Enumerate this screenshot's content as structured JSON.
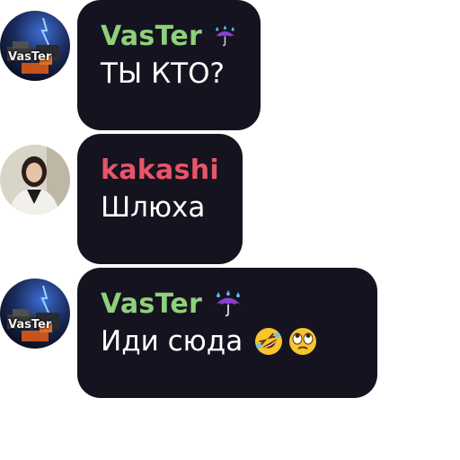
{
  "messages": [
    {
      "sender": "VasTer",
      "sender_color": "#8ed17a",
      "avatar_label": "VasTer",
      "avatar_icon": "vaster-avatar",
      "badge_icon": "umbrella-with-rain-icon",
      "text": "ТЫ КТО?",
      "emojis": []
    },
    {
      "sender": "kakashi",
      "sender_color": "#e8556a",
      "avatar_icon": "woman-photo-avatar",
      "text": "Шлюха",
      "emojis": []
    },
    {
      "sender": "VasTer",
      "sender_color": "#8ed17a",
      "avatar_label": "VasTer",
      "avatar_icon": "vaster-avatar",
      "badge_icon": "umbrella-with-rain-icon",
      "text": "Иди сюда",
      "emojis": [
        "rolling-on-floor-laughing-emoji",
        "face-with-rolling-eyes-emoji"
      ]
    }
  ],
  "colors": {
    "bubble_bg": "#15131f",
    "message_text": "#ffffff"
  }
}
